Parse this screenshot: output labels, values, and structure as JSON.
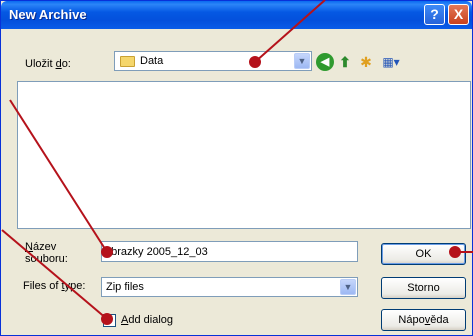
{
  "window": {
    "title": "New Archive",
    "help_glyph": "?",
    "close_glyph": "X"
  },
  "save_in": {
    "label_prefix": "Uložit ",
    "label_underlined": "d",
    "label_suffix": "o:",
    "value": "Data",
    "icon": "folder-icon"
  },
  "toolbar": {
    "back_icon": "back-icon",
    "up_icon": "up-folder-icon",
    "new_folder_icon": "new-folder-icon",
    "view_menu_icon": "view-menu-icon"
  },
  "file_name": {
    "label_underlined": "N",
    "label_rest_line1": "ázev",
    "label_line2": "souboru:",
    "value": "obrazky 2005_12_03"
  },
  "file_type": {
    "label_prefix": "Files of ",
    "label_underlined": "t",
    "label_suffix": "ype:",
    "value": "Zip files"
  },
  "add_dialog": {
    "checked": true,
    "label_underlined": "A",
    "label_rest": "dd dialog"
  },
  "buttons": {
    "ok": "OK",
    "cancel": "Storno",
    "help_prefix": "Nápo",
    "help_underlined": "v",
    "help_suffix": "ěda"
  },
  "colors": {
    "titlebar": "#0558e3",
    "dialog_bg": "#ece9d8",
    "callout": "#b5121b"
  }
}
